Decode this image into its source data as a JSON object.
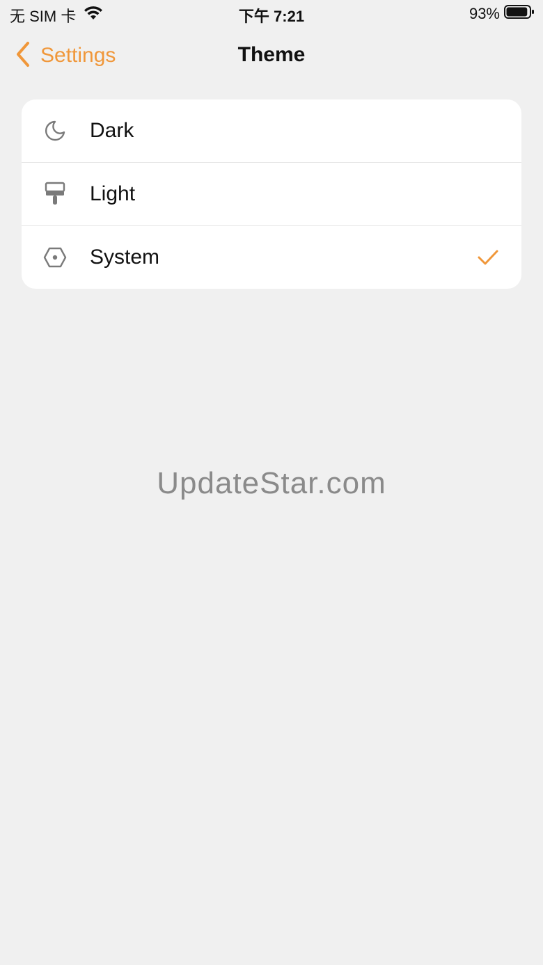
{
  "status_bar": {
    "carrier": "无 SIM 卡",
    "time": "下午 7:21",
    "battery_percent": "93%",
    "battery_level": 0.93
  },
  "nav": {
    "back_label": "Settings",
    "title": "Theme"
  },
  "theme_options": [
    {
      "label": "Dark",
      "icon": "moon-icon",
      "selected": false
    },
    {
      "label": "Light",
      "icon": "paint-roller-icon",
      "selected": false
    },
    {
      "label": "System",
      "icon": "hexagon-dot-icon",
      "selected": true
    }
  ],
  "watermark": "UpdateStar.com",
  "colors": {
    "accent": "#f0973a",
    "background": "#f0f0f0",
    "card": "#ffffff",
    "icon_gray": "#7a7a7a"
  }
}
